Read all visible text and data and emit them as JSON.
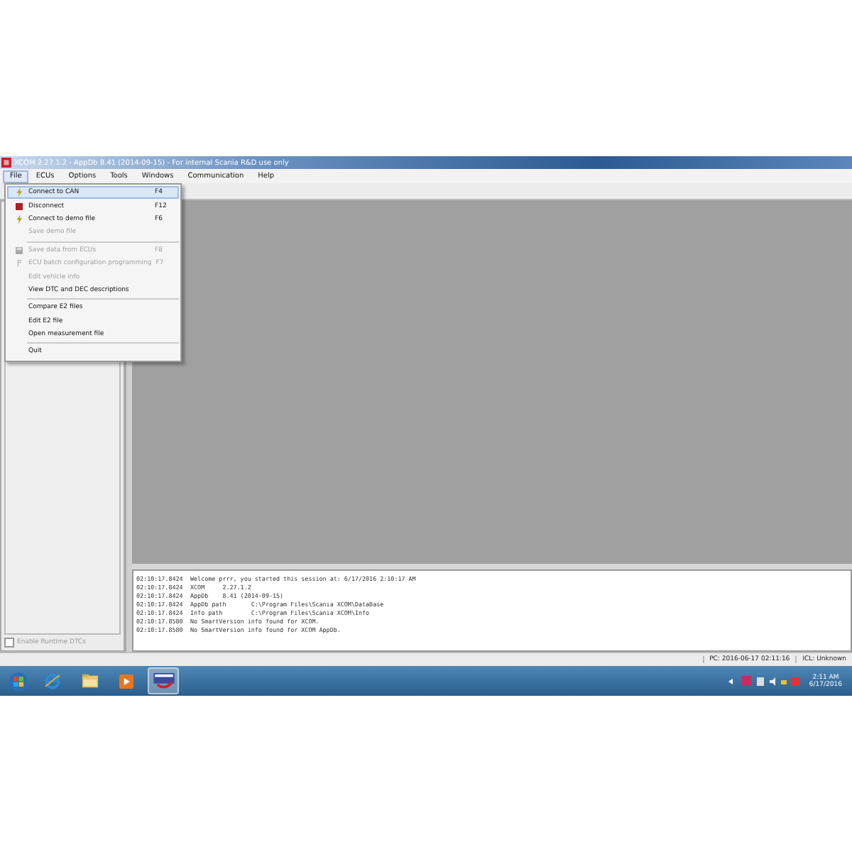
{
  "window": {
    "title": "XCOM 2.27.1.2 - AppDb 8.41 (2014-09-15) - For internal Scania R&D use only"
  },
  "menu_bar": [
    {
      "label": "File",
      "selected": true
    },
    {
      "label": "ECUs",
      "selected": false
    },
    {
      "label": "Options",
      "selected": false
    },
    {
      "label": "Tools",
      "selected": false
    },
    {
      "label": "Windows",
      "selected": false
    },
    {
      "label": "Communication",
      "selected": false
    },
    {
      "label": "Help",
      "selected": false
    }
  ],
  "file_menu": [
    {
      "kind": "connect",
      "label": "Connect to CAN",
      "shortcut": "F4",
      "disabled": false,
      "selected": true
    },
    {
      "kind": "disconnect",
      "label": "Disconnect",
      "shortcut": "F12",
      "disabled": false,
      "selected": false
    },
    {
      "kind": "connect",
      "label": "Connect to demo file",
      "shortcut": "F6",
      "disabled": false,
      "selected": false
    },
    {
      "kind": "item",
      "label": "Save demo file",
      "disabled": true,
      "selected": false
    },
    {
      "kind": "separator"
    },
    {
      "kind": "save",
      "label": "Save data from ECUs",
      "shortcut": "F8",
      "disabled": true,
      "selected": false
    },
    {
      "kind": "batch",
      "label": "ECU batch configuration programming",
      "shortcut": "F7",
      "disabled": true,
      "selected": false
    },
    {
      "kind": "item",
      "label": "Edit vehicle info",
      "disabled": true,
      "selected": false
    },
    {
      "kind": "item",
      "label": "View DTC and DEC descriptions",
      "disabled": false,
      "selected": false
    },
    {
      "kind": "separator"
    },
    {
      "kind": "item",
      "label": "Compare E2 files",
      "disabled": false,
      "selected": false
    },
    {
      "kind": "item",
      "label": "Edit E2 file",
      "disabled": false,
      "selected": false
    },
    {
      "kind": "item",
      "label": "Open measurement file",
      "disabled": false,
      "selected": false
    },
    {
      "kind": "separator"
    },
    {
      "kind": "item",
      "label": "Quit",
      "disabled": false,
      "selected": false
    }
  ],
  "left_panel": {
    "checkbox": {
      "label": "Enable Runtime DTCs",
      "checked": false,
      "disabled": true
    }
  },
  "log": [
    {
      "time": "02:10:17.8424",
      "message": "Welcome prrr, you started this session at: 6/17/2016 2:10:17 AM"
    },
    {
      "time": "02:10:17.8424",
      "message": "XCOM     2.27.1.2"
    },
    {
      "time": "02:10:17.8424",
      "message": "AppDb    8.41 (2014-09-15)"
    },
    {
      "time": "02:10:17.8424",
      "message": "AppDb path       C:\\Program Files\\Scania XCOM\\DataBase"
    },
    {
      "time": "02:10:17.8424",
      "message": "Info path        C:\\Program Files\\Scania XCOM\\Info"
    },
    {
      "time": "02:10:17.8580",
      "message": "No SmartVersion info found for XCOM."
    },
    {
      "time": "02:10:17.8580",
      "message": "No SmartVersion info found for XCOM AppDb."
    }
  ],
  "status_bar": [
    "PC: 2016-06-17 02:11:16",
    "ICL: Unknown"
  ],
  "taskbar": {
    "apps": [
      {
        "kind": "ie",
        "selected": false
      },
      {
        "kind": "folder",
        "selected": false
      },
      {
        "kind": "media",
        "selected": false
      },
      {
        "kind": "xcom",
        "selected": true
      }
    ],
    "clock": {
      "time": "2:11 AM",
      "date": "6/17/2016"
    }
  }
}
